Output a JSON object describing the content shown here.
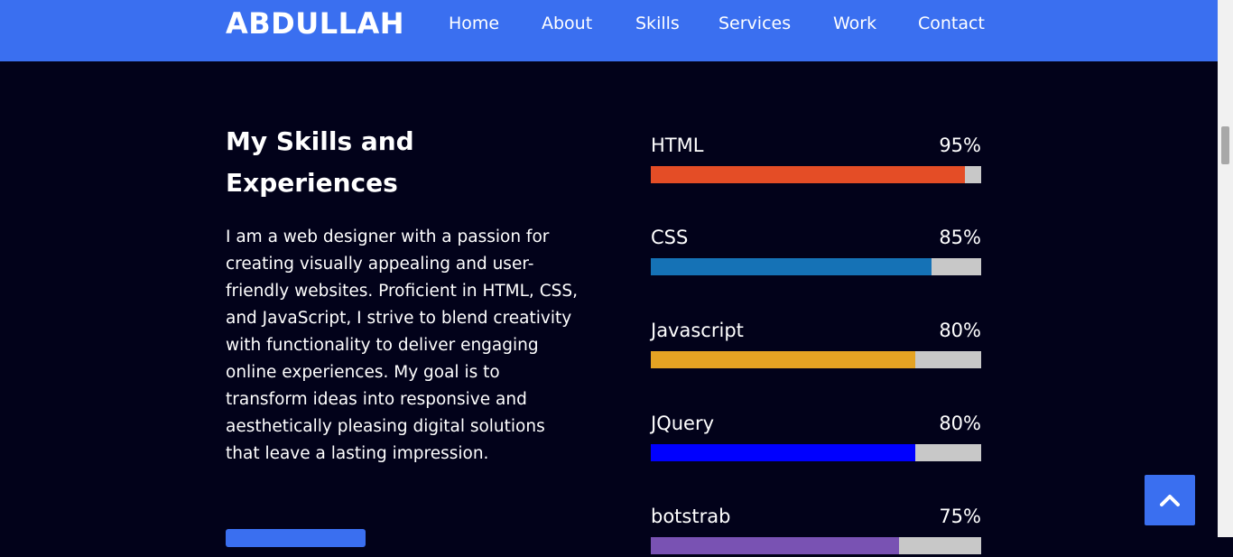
{
  "navbar": {
    "brand": "ABDULLAH",
    "links": [
      "Home",
      "About",
      "Skills",
      "Services",
      "Work",
      "Contact"
    ]
  },
  "about": {
    "heading": "My Skills and Experiences",
    "paragraph": "I am a web designer with a passion for creating visually appealing and user-friendly websites. Proficient in HTML, CSS, and JavaScript, I strive to blend creativity with functionality to deliver engaging online experiences. My goal is to transform ideas into responsive and aesthetically pleasing digital solutions that leave a lasting impression."
  },
  "skills": [
    {
      "name": "HTML",
      "percent_label": "95%",
      "value": 95,
      "color": "#e44d26"
    },
    {
      "name": "CSS",
      "percent_label": "85%",
      "value": 85,
      "color": "#1572b6"
    },
    {
      "name": "Javascript",
      "percent_label": "80%",
      "value": 80,
      "color": "#e5a323"
    },
    {
      "name": "JQuery",
      "percent_label": "80%",
      "value": 80,
      "color": "#0000ff"
    },
    {
      "name": "botstrab",
      "percent_label": "75%",
      "value": 75,
      "color": "#7952b3"
    }
  ],
  "colors": {
    "accent": "#3a6ff0",
    "background": "#02021a",
    "track": "#c8c8c8"
  },
  "icons": {
    "back_to_top": "chevron-up-icon"
  }
}
